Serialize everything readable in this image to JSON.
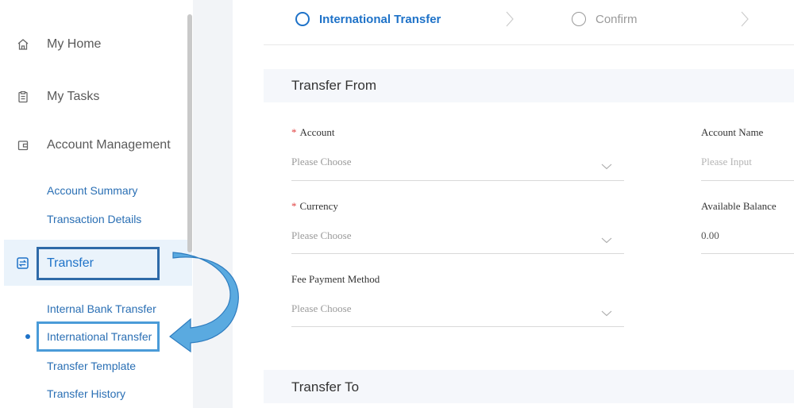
{
  "sidebar": {
    "items": [
      {
        "label": "My Home",
        "icon": "home-icon"
      },
      {
        "label": "My Tasks",
        "icon": "clipboard-icon"
      },
      {
        "label": "Account Management",
        "icon": "wallet-icon"
      }
    ],
    "account_sub": [
      "Account Summary",
      "Transaction Details"
    ],
    "transfer": {
      "label": "Transfer",
      "icon": "transfer-icon"
    },
    "transfer_sub": [
      "Internal Bank Transfer",
      "International Transfer",
      "Transfer Template",
      "Transfer History"
    ]
  },
  "steps": {
    "step1": "International Transfer",
    "step2": "Confirm"
  },
  "transfer_from": {
    "title": "Transfer From",
    "account": {
      "label": "Account",
      "placeholder": "Please Choose"
    },
    "account_name": {
      "label": "Account Name",
      "placeholder": "Please Input"
    },
    "currency": {
      "label": "Currency",
      "placeholder": "Please Choose"
    },
    "available_balance": {
      "label": "Available Balance",
      "value": "0.00"
    },
    "fee_method": {
      "label": "Fee Payment Method",
      "placeholder": "Please Choose"
    }
  },
  "transfer_to": {
    "title": "Transfer To"
  },
  "required_mark": "*",
  "colors": {
    "accent": "#1e72c8",
    "highlight_dark": "#2e6aa8",
    "highlight_light": "#4a9bd8",
    "required": "#e04444"
  }
}
